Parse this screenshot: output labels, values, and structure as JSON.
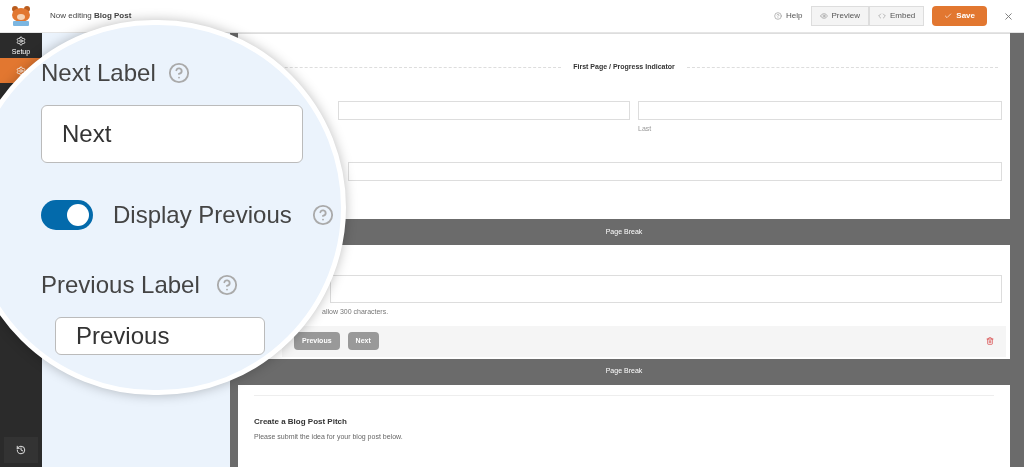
{
  "header": {
    "title": "Now editing **Blog Post**",
    "buttons": [
      {
        "label": "Help",
        "kind": "link"
      },
      {
        "label": "Preview",
        "kind": "outline"
      },
      {
        "label": "Embed",
        "kind": "outline"
      },
      {
        "label": "Save",
        "kind": "primary"
      }
    ]
  },
  "sidebar": {
    "items": [
      {
        "label": "Setup",
        "selected": false
      },
      {
        "selected": true
      }
    ]
  },
  "magnifier": {
    "next_label": "Next Label",
    "next_value": "Next",
    "display_previous": {
      "label": "Display Previous",
      "on": true
    },
    "previous_label": "Previous Label",
    "previous_value": "Previous"
  },
  "form": {
    "sections": [
      {
        "kind": "divider",
        "label": "First Page / Progress Indicator"
      },
      {
        "kind": "name_fields",
        "sublabel": "Last"
      },
      {
        "kind": "field"
      },
      {
        "kind": "page_break",
        "label": "Page Break"
      },
      {
        "kind": "textarea",
        "hint": "allow 300 characters."
      },
      {
        "kind": "nav",
        "buttons": [
          "Previous",
          "Next"
        ]
      },
      {
        "kind": "page_break",
        "label": "Page Break"
      },
      {
        "kind": "heading",
        "title": "Create a Blog Post Pitch",
        "text": "Please submit the idea for your blog post below."
      }
    ]
  }
}
